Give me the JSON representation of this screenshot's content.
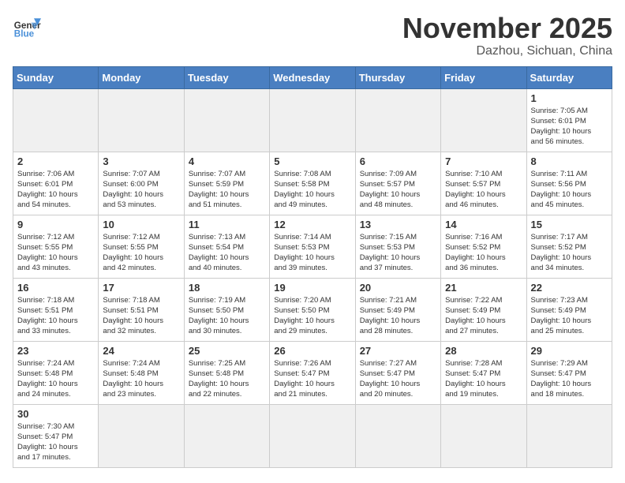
{
  "header": {
    "logo_general": "General",
    "logo_blue": "Blue",
    "month_year": "November 2025",
    "location": "Dazhou, Sichuan, China"
  },
  "weekdays": [
    "Sunday",
    "Monday",
    "Tuesday",
    "Wednesday",
    "Thursday",
    "Friday",
    "Saturday"
  ],
  "weeks": [
    [
      {
        "day": "",
        "info": ""
      },
      {
        "day": "",
        "info": ""
      },
      {
        "day": "",
        "info": ""
      },
      {
        "day": "",
        "info": ""
      },
      {
        "day": "",
        "info": ""
      },
      {
        "day": "",
        "info": ""
      },
      {
        "day": "1",
        "info": "Sunrise: 7:05 AM\nSunset: 6:01 PM\nDaylight: 10 hours\nand 56 minutes."
      }
    ],
    [
      {
        "day": "2",
        "info": "Sunrise: 7:06 AM\nSunset: 6:01 PM\nDaylight: 10 hours\nand 54 minutes."
      },
      {
        "day": "3",
        "info": "Sunrise: 7:07 AM\nSunset: 6:00 PM\nDaylight: 10 hours\nand 53 minutes."
      },
      {
        "day": "4",
        "info": "Sunrise: 7:07 AM\nSunset: 5:59 PM\nDaylight: 10 hours\nand 51 minutes."
      },
      {
        "day": "5",
        "info": "Sunrise: 7:08 AM\nSunset: 5:58 PM\nDaylight: 10 hours\nand 49 minutes."
      },
      {
        "day": "6",
        "info": "Sunrise: 7:09 AM\nSunset: 5:57 PM\nDaylight: 10 hours\nand 48 minutes."
      },
      {
        "day": "7",
        "info": "Sunrise: 7:10 AM\nSunset: 5:57 PM\nDaylight: 10 hours\nand 46 minutes."
      },
      {
        "day": "8",
        "info": "Sunrise: 7:11 AM\nSunset: 5:56 PM\nDaylight: 10 hours\nand 45 minutes."
      }
    ],
    [
      {
        "day": "9",
        "info": "Sunrise: 7:12 AM\nSunset: 5:55 PM\nDaylight: 10 hours\nand 43 minutes."
      },
      {
        "day": "10",
        "info": "Sunrise: 7:12 AM\nSunset: 5:55 PM\nDaylight: 10 hours\nand 42 minutes."
      },
      {
        "day": "11",
        "info": "Sunrise: 7:13 AM\nSunset: 5:54 PM\nDaylight: 10 hours\nand 40 minutes."
      },
      {
        "day": "12",
        "info": "Sunrise: 7:14 AM\nSunset: 5:53 PM\nDaylight: 10 hours\nand 39 minutes."
      },
      {
        "day": "13",
        "info": "Sunrise: 7:15 AM\nSunset: 5:53 PM\nDaylight: 10 hours\nand 37 minutes."
      },
      {
        "day": "14",
        "info": "Sunrise: 7:16 AM\nSunset: 5:52 PM\nDaylight: 10 hours\nand 36 minutes."
      },
      {
        "day": "15",
        "info": "Sunrise: 7:17 AM\nSunset: 5:52 PM\nDaylight: 10 hours\nand 34 minutes."
      }
    ],
    [
      {
        "day": "16",
        "info": "Sunrise: 7:18 AM\nSunset: 5:51 PM\nDaylight: 10 hours\nand 33 minutes."
      },
      {
        "day": "17",
        "info": "Sunrise: 7:18 AM\nSunset: 5:51 PM\nDaylight: 10 hours\nand 32 minutes."
      },
      {
        "day": "18",
        "info": "Sunrise: 7:19 AM\nSunset: 5:50 PM\nDaylight: 10 hours\nand 30 minutes."
      },
      {
        "day": "19",
        "info": "Sunrise: 7:20 AM\nSunset: 5:50 PM\nDaylight: 10 hours\nand 29 minutes."
      },
      {
        "day": "20",
        "info": "Sunrise: 7:21 AM\nSunset: 5:49 PM\nDaylight: 10 hours\nand 28 minutes."
      },
      {
        "day": "21",
        "info": "Sunrise: 7:22 AM\nSunset: 5:49 PM\nDaylight: 10 hours\nand 27 minutes."
      },
      {
        "day": "22",
        "info": "Sunrise: 7:23 AM\nSunset: 5:49 PM\nDaylight: 10 hours\nand 25 minutes."
      }
    ],
    [
      {
        "day": "23",
        "info": "Sunrise: 7:24 AM\nSunset: 5:48 PM\nDaylight: 10 hours\nand 24 minutes."
      },
      {
        "day": "24",
        "info": "Sunrise: 7:24 AM\nSunset: 5:48 PM\nDaylight: 10 hours\nand 23 minutes."
      },
      {
        "day": "25",
        "info": "Sunrise: 7:25 AM\nSunset: 5:48 PM\nDaylight: 10 hours\nand 22 minutes."
      },
      {
        "day": "26",
        "info": "Sunrise: 7:26 AM\nSunset: 5:47 PM\nDaylight: 10 hours\nand 21 minutes."
      },
      {
        "day": "27",
        "info": "Sunrise: 7:27 AM\nSunset: 5:47 PM\nDaylight: 10 hours\nand 20 minutes."
      },
      {
        "day": "28",
        "info": "Sunrise: 7:28 AM\nSunset: 5:47 PM\nDaylight: 10 hours\nand 19 minutes."
      },
      {
        "day": "29",
        "info": "Sunrise: 7:29 AM\nSunset: 5:47 PM\nDaylight: 10 hours\nand 18 minutes."
      }
    ],
    [
      {
        "day": "30",
        "info": "Sunrise: 7:30 AM\nSunset: 5:47 PM\nDaylight: 10 hours\nand 17 minutes."
      },
      {
        "day": "",
        "info": ""
      },
      {
        "day": "",
        "info": ""
      },
      {
        "day": "",
        "info": ""
      },
      {
        "day": "",
        "info": ""
      },
      {
        "day": "",
        "info": ""
      },
      {
        "day": "",
        "info": ""
      }
    ]
  ]
}
